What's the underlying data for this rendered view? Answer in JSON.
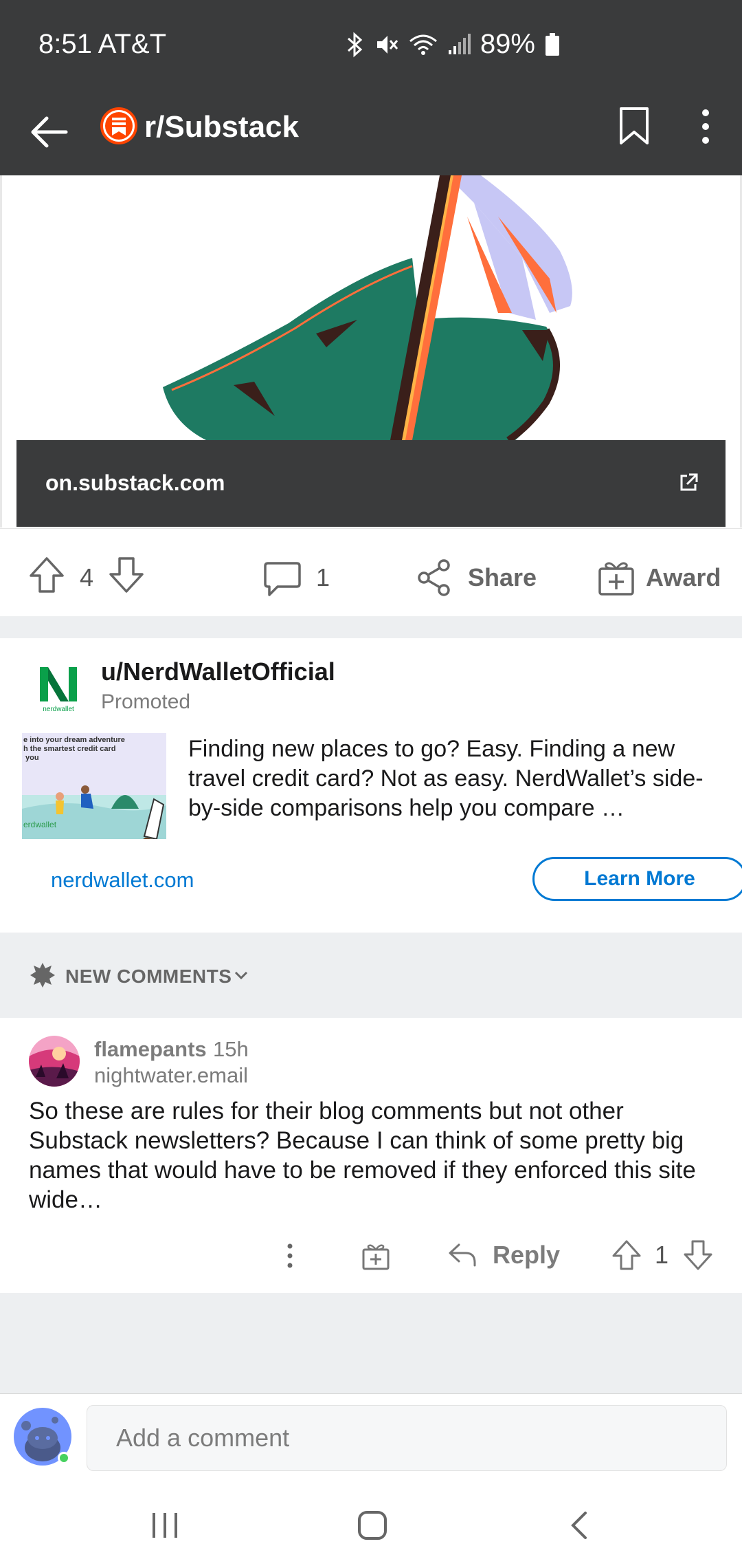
{
  "status_bar": {
    "time_carrier": "8:51 AT&T",
    "battery": "89%"
  },
  "app_bar": {
    "title": "r/Substack"
  },
  "post": {
    "link_domain": "on.substack.com",
    "score": "4",
    "comment_count": "1",
    "share_label": "Share",
    "award_label": "Award"
  },
  "promoted": {
    "user": "u/NerdWalletOfficial",
    "tag": "Promoted",
    "logo_text": "nerdwallet",
    "thumb_text": "e into your dream adventure\nh the smartest credit card\n you",
    "thumb_brand": "erdwallet",
    "body": "Finding new places to go? Easy. Finding a new travel credit card? Not as easy. NerdWallet’s side-by-side comparisons help you compare …",
    "link": "nerdwallet.com",
    "cta": "Learn More"
  },
  "new_comments": {
    "label": "NEW COMMENTS"
  },
  "comment": {
    "user": "flamepants",
    "time": "15h",
    "flair": "nightwater.email",
    "body": "So these are rules for their blog comments but not other Substack newsletters? Because I can think of some pretty big names that would have to be removed if they enforced this site wide…",
    "reply_label": "Reply",
    "score": "1"
  },
  "composer": {
    "placeholder": "Add a comment"
  },
  "colors": {
    "header_bg": "#3a3b3c",
    "link_blue": "#0079d3",
    "subreddit_orange": "#ff4500",
    "online_green": "#46d160"
  }
}
